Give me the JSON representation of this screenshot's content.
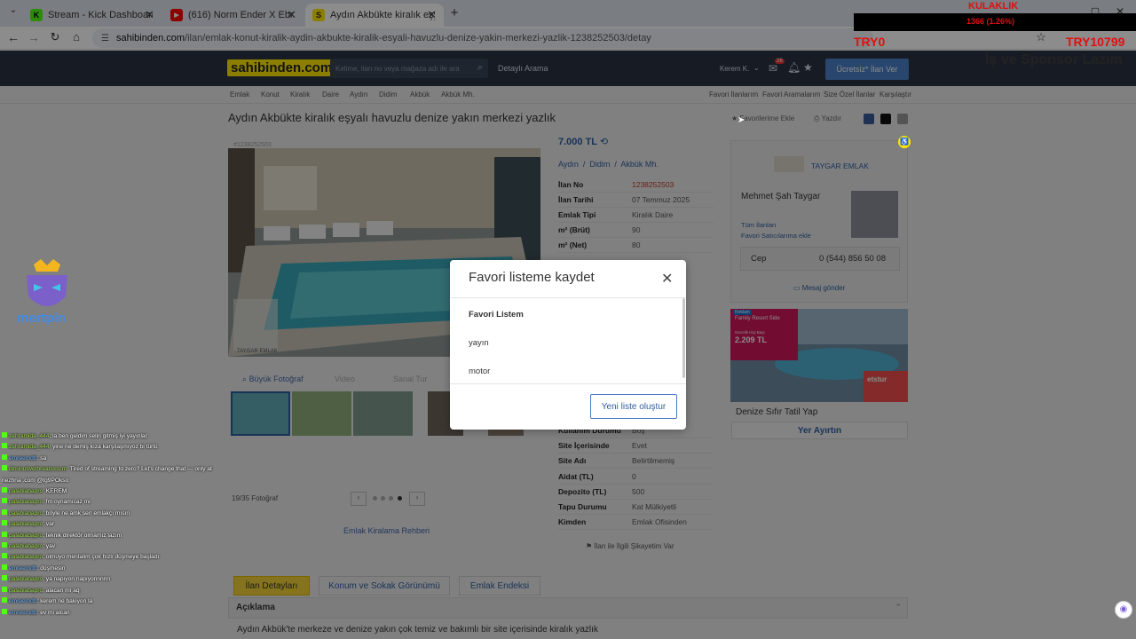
{
  "browser": {
    "tabs": [
      {
        "title": "Stream - Kick Dashboard",
        "icon": "kick-icon"
      },
      {
        "title": "(616) Norm Ender X Ebru Gündeş",
        "icon": "youtube-icon"
      },
      {
        "title": "Aydın Akbükte kiralık eşyalı hav",
        "icon": "sahibinden-icon"
      }
    ],
    "url_domain": "sahibinden.com",
    "url_path": "/ilan/emlak-konut-kiralik-aydin-akbukte-kiralik-esyali-havuzlu-denize-yakin-merkezi-yazlik-1238252503/detay"
  },
  "stream_overlay": {
    "kulaklik": "KULAKLIK",
    "ticker": "1366 (1.26%)",
    "try0": "TRY0",
    "try_total": "TRY10799",
    "sponsor": "İş ve Sponsor Lazım",
    "brand": "mertpin"
  },
  "site": {
    "logo": "sahibinden.com",
    "search_placeholder": "Kelime, ilan no veya mağaza adı ile ara",
    "detailed_search": "Detaylı Arama",
    "user": "Kerem K.",
    "msg_count": "26",
    "post_button": "Ücretsiz* İlan Ver",
    "breadcrumbs": [
      "Emlak",
      "Konut",
      "Kiralık",
      "Daire",
      "Aydın",
      "Didim",
      "Akbük",
      "Akbük Mh."
    ],
    "right_links": [
      "Favori İlanlarım",
      "Favori Aramalarım",
      "Size Özel İlanlar",
      "Karşılaştır"
    ]
  },
  "listing": {
    "title": "Aydın Akbükte kiralık eşyalı havuzlu denize yakın merkezi yazlık",
    "add_fav": "Favorilerime Ekle",
    "print": "Yazdır",
    "ad_id": "#1238252503",
    "price": "7.000 TL",
    "location": [
      "Aydın",
      "Didim",
      "Akbük Mh."
    ],
    "big_photo": "Büyük Fotoğraf",
    "video": "Video",
    "pano": "Sanal Tur",
    "photo_counter": "19/35 Fotoğraf",
    "guide": "Emlak Kiralama Rehberi",
    "complaint": "İlan ile İlgili Şikayetim Var",
    "photo_watermark": "TAYGAR EMLAK",
    "details_top": [
      {
        "k": "İlan No",
        "v": "1238252503"
      },
      {
        "k": "İlan Tarihi",
        "v": "07 Temmuz 2025"
      },
      {
        "k": "Emlak Tipi",
        "v": "Kiralık Daire"
      },
      {
        "k": "m² (Brüt)",
        "v": "90"
      },
      {
        "k": "m² (Net)",
        "v": "80"
      }
    ],
    "details_bottom": [
      {
        "k": "Kullanım Durumu",
        "v": "Boş"
      },
      {
        "k": "Site İçerisinde",
        "v": "Evet"
      },
      {
        "k": "Site Adı",
        "v": "Belirtilmemiş"
      },
      {
        "k": "Aidat (TL)",
        "v": "0"
      },
      {
        "k": "Depozito (TL)",
        "v": "500"
      },
      {
        "k": "Tapu Durumu",
        "v": "Kat Mülkiyetli"
      },
      {
        "k": "Kimden",
        "v": "Emlak Ofisinden"
      }
    ]
  },
  "seller": {
    "agency": "TAYGAR EMLAK",
    "name": "Mehmet Şah Taygar",
    "all_ads": "Tüm İlanları",
    "fav_seller": "Favori Satıcılarıma ekle",
    "phone_label": "Cep",
    "phone": "0 (544) 856 50 08",
    "message": "Mesaj gönder"
  },
  "ad_banner": {
    "caption": "Denize Sıfır Tatil Yap",
    "button": "Yer Ayırtın",
    "promo1": "Reklam",
    "promo2": "Family Resort Side",
    "promo3": "Gecelik Kişi Başı",
    "promo4": "2.209 TL",
    "promo5": "etstur"
  },
  "detail_tabs": [
    "İlan Detayları",
    "Konum ve Sokak Görünümü",
    "Emlak Endeksi"
  ],
  "description": {
    "title": "Açıklama",
    "text": "Aydın Akbük'te merkeze ve denize yakın çok temiz ve bakımlı bir site içerisinde kiralık yazlık"
  },
  "modal": {
    "title": "Favori listeme kaydet",
    "items": [
      "Favori Listem",
      "yayın",
      "motor"
    ],
    "new_list": "Yeni liste oluştur"
  },
  "chat": [
    {
      "u": "zehramida_444",
      "m": ": la ben geldim selin gitmiş iyi yayınlar"
    },
    {
      "u": "zehramida_444",
      "m": ": yine ne demiş kıza karşılaşmıyoz bi türlü"
    },
    {
      "u": "emreemdb",
      "m": ": sa"
    },
    {
      "u": "diminutivethreatsxscm",
      "m": ": Tired of streaming to zero? Let's change that — only at nezhna .com @tg9POkso"
    },
    {
      "u": "palabiabapro",
      "m": ": KEREM"
    },
    {
      "u": "palabiabapro",
      "m": ": fm oynamıcaz mı"
    },
    {
      "u": "palabiabapro",
      "m": ": böyle ne amk sen emlakçı mısın"
    },
    {
      "u": "palabiabapro",
      "m": ": var"
    },
    {
      "u": "palabiabapro",
      "m": ": teknik direktör olmamız lazım"
    },
    {
      "u": "palabiabapro",
      "m": ": yav"
    },
    {
      "u": "palabiabapro",
      "m": ": olmuyo mentalim çok hızlı düşmeye başladı"
    },
    {
      "u": "emreemdb",
      "m": ": düşmesin"
    },
    {
      "u": "palabiabapro",
      "m": ": ya napıyon napıyonnnnn"
    },
    {
      "u": "palabiabapro",
      "m": ": alacan mı aq"
    },
    {
      "u": "emreemdb",
      "m": ": kerem ne bakiyon la"
    },
    {
      "u": "emreemdb",
      "m": ": ev mi alcan"
    }
  ]
}
